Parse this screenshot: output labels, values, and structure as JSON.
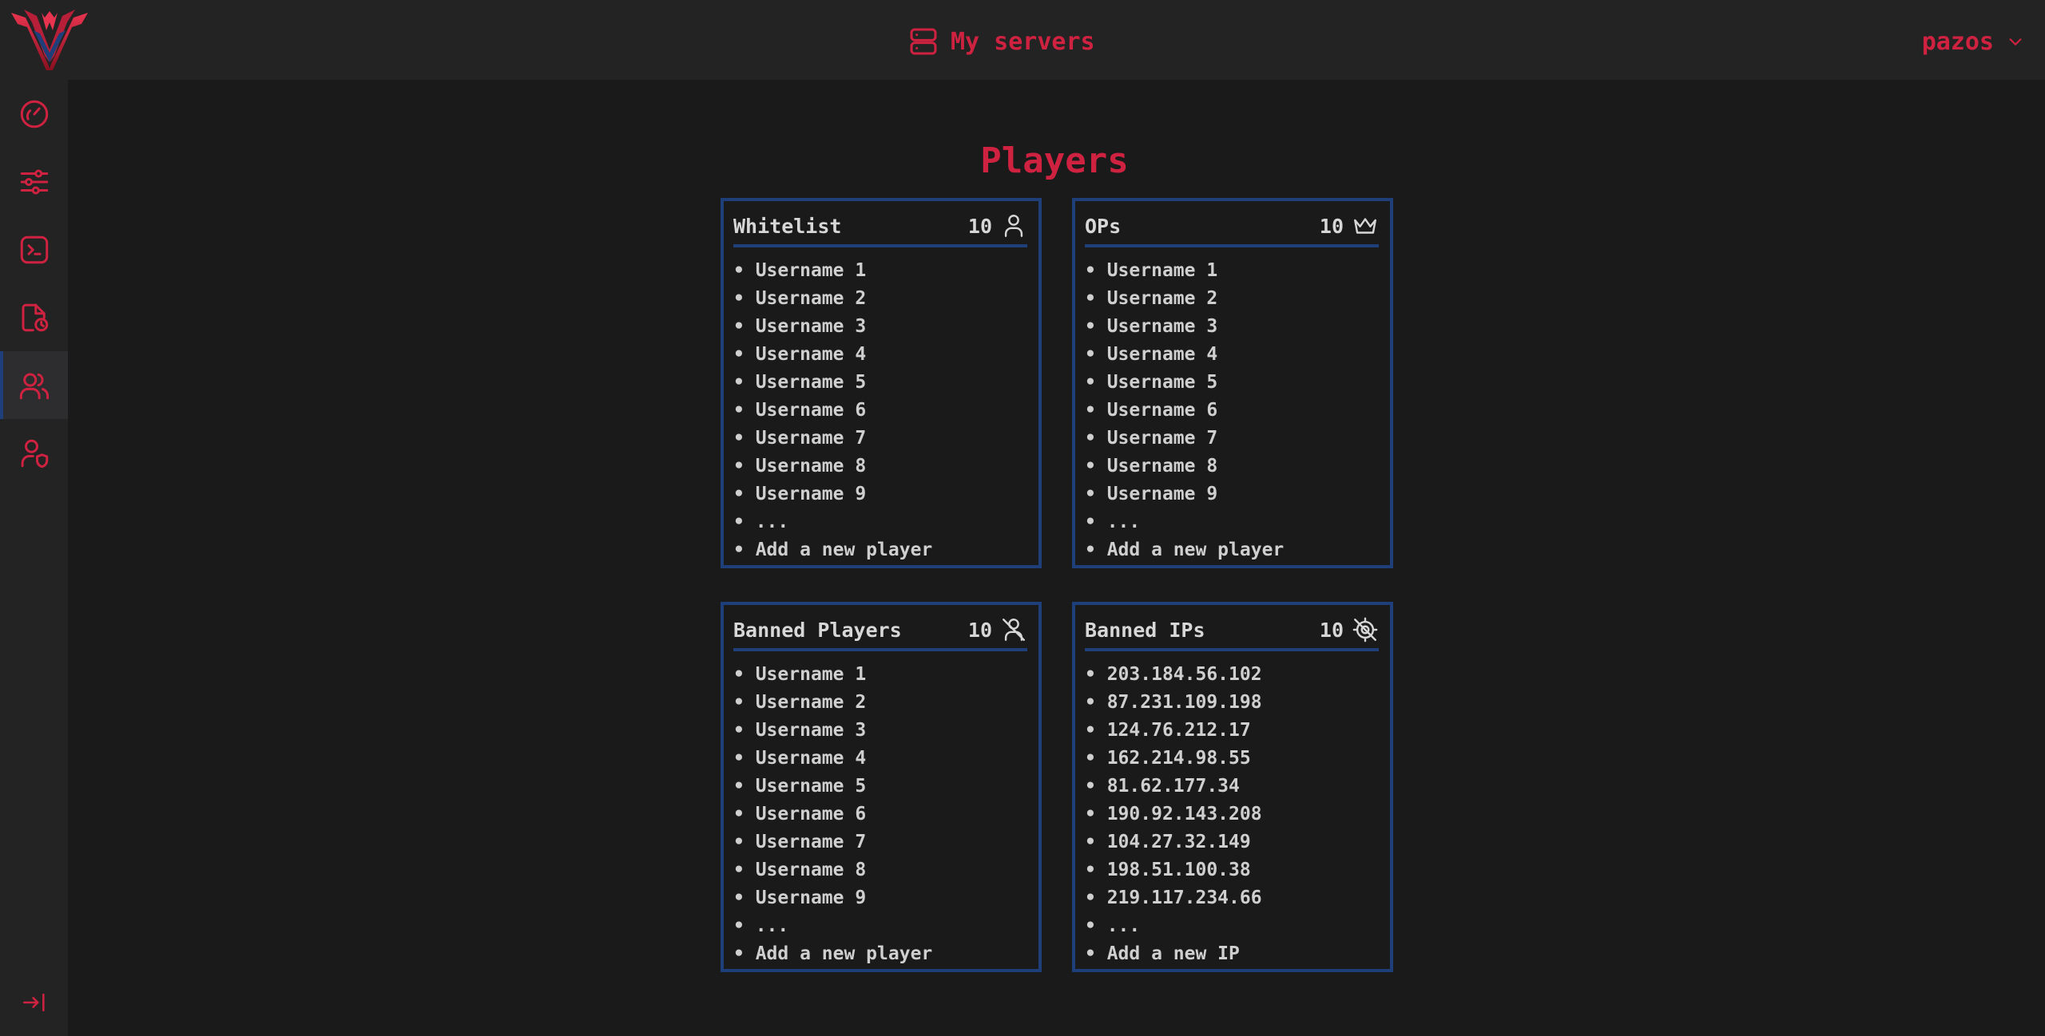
{
  "header": {
    "title": "My servers",
    "user": "pazos"
  },
  "sidebar": {
    "items": [
      {
        "icon": "dashboard-gauge-icon",
        "active": false
      },
      {
        "icon": "settings-sliders-icon",
        "active": false
      },
      {
        "icon": "console-terminal-icon",
        "active": false
      },
      {
        "icon": "files-icon",
        "active": false
      },
      {
        "icon": "players-users-icon",
        "active": true
      },
      {
        "icon": "user-shield-icon",
        "active": false
      }
    ],
    "collapse_icon": "collapse-arrow-icon"
  },
  "page": {
    "title": "Players"
  },
  "cards": {
    "whitelist": {
      "title": "Whitelist",
      "count": "10",
      "icon": "user-icon",
      "items": [
        "Username 1",
        "Username 2",
        "Username 3",
        "Username 4",
        "Username 5",
        "Username 6",
        "Username 7",
        "Username 8",
        "Username 9",
        "..."
      ],
      "add_label": "Add a new player"
    },
    "ops": {
      "title": "OPs",
      "count": "10",
      "icon": "crown-icon",
      "items": [
        "Username 1",
        "Username 2",
        "Username 3",
        "Username 4",
        "Username 5",
        "Username 6",
        "Username 7",
        "Username 8",
        "Username 9",
        "..."
      ],
      "add_label": "Add a new player"
    },
    "banned_players": {
      "title": "Banned Players",
      "count": "10",
      "icon": "user-banned-icon",
      "items": [
        "Username 1",
        "Username 2",
        "Username 3",
        "Username 4",
        "Username 5",
        "Username 6",
        "Username 7",
        "Username 8",
        "Username 9",
        "..."
      ],
      "add_label": "Add a new player"
    },
    "banned_ips": {
      "title": "Banned IPs",
      "count": "10",
      "icon": "location-off-icon",
      "items": [
        "203.184.56.102",
        "87.231.109.198",
        "124.76.212.17",
        "162.214.98.55",
        "81.62.177.34",
        "190.92.143.208",
        "104.27.32.149",
        "198.51.100.38",
        "219.117.234.66",
        "..."
      ],
      "add_label": "Add a new IP"
    }
  },
  "colors": {
    "accent": "#cf2240",
    "border": "#1e3f7a",
    "background": "#1a1a1b",
    "panel": "#232324",
    "text": "#d7d7d7"
  }
}
